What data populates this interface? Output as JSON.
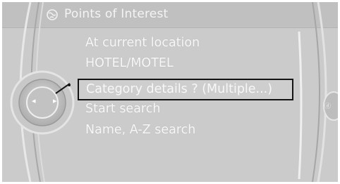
{
  "header": {
    "title": "Points of Interest",
    "icon": "poi-globe-icon"
  },
  "menu": {
    "items": [
      {
        "label": "At current location"
      },
      {
        "label": "HOTEL/MOTEL"
      },
      {
        "label": "Category details ? (Multiple...)",
        "selected": true
      },
      {
        "label": "Start search"
      },
      {
        "label": "Name, A-Z search"
      }
    ]
  },
  "controller": {
    "left_arrow": "◂",
    "right_arrow": "▸",
    "right_knob_label": "ⓓ"
  },
  "colors": {
    "screen": "#cbcbcb",
    "header": "#c0c0c0",
    "text": "#f7f7f7",
    "selection_border": "#141414"
  }
}
